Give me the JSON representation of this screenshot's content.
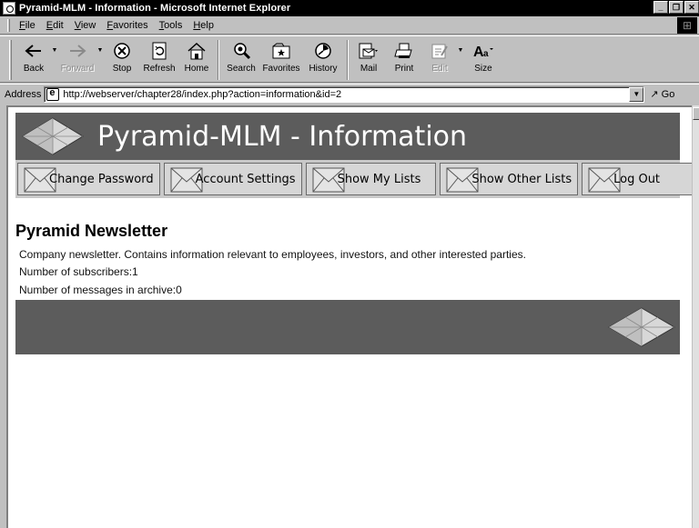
{
  "window": {
    "title": "Pyramid-MLM - Information - Microsoft Internet Explorer"
  },
  "menu": [
    "File",
    "Edit",
    "View",
    "Favorites",
    "Tools",
    "Help"
  ],
  "toolbar": {
    "back": "Back",
    "forward": "Forward",
    "stop": "Stop",
    "refresh": "Refresh",
    "home": "Home",
    "search": "Search",
    "favorites": "Favorites",
    "history": "History",
    "mail": "Mail",
    "print": "Print",
    "edit": "Edit",
    "size": "Size"
  },
  "address": {
    "label": "Address",
    "url": "http://webserver/chapter28/index.php?action=information&id=2",
    "go": "Go"
  },
  "page": {
    "banner_title": "Pyramid-MLM - Information",
    "nav": [
      "Change Password",
      "Account Settings",
      "Show My Lists",
      "Show Other Lists",
      "Log Out"
    ],
    "section_title": "Pyramid Newsletter",
    "description": "Company newsletter. Contains information relevant to employees, investors, and other interested parties.",
    "subscribers": "Number of subscribers:1",
    "messages": "Number of messages in archive:0"
  },
  "colors": {
    "banner": "#5c5c5c",
    "navbar": "#c8c8c8",
    "titlebar": "#000000"
  }
}
